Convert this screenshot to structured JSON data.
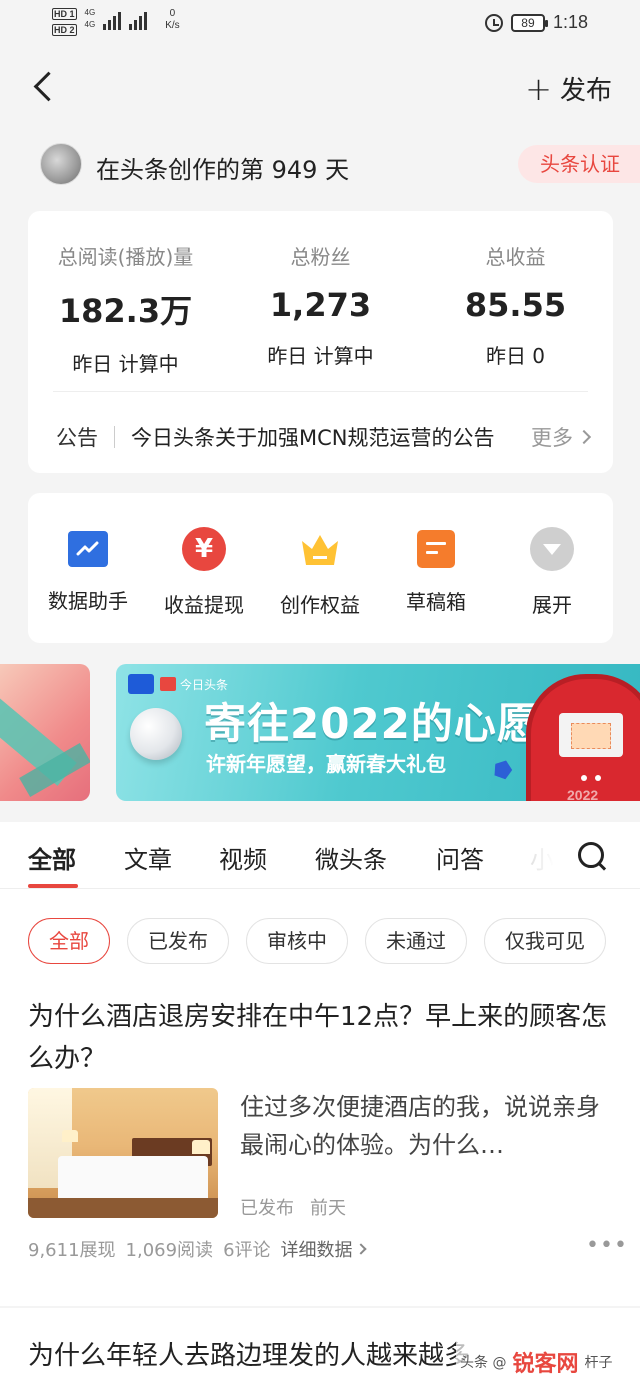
{
  "status_bar": {
    "hd1": "HD 1",
    "hd2": "HD 2",
    "net1": "4G",
    "net2": "4G",
    "speed_value": "0",
    "speed_unit": "K/s",
    "battery": "89",
    "time": "1:18"
  },
  "nav": {
    "publish_label": "发布",
    "plus_glyph": "+"
  },
  "creator": {
    "text": "在头条创作的第 949 天",
    "cert_label": "头条认证"
  },
  "stats": {
    "items": [
      {
        "label": "总阅读(播放)量",
        "value": "182.3万",
        "sub": "昨日 计算中"
      },
      {
        "label": "总粉丝",
        "value": "1,273",
        "sub": "昨日 计算中"
      },
      {
        "label": "总收益",
        "value": "85.55",
        "sub": "昨日 0"
      }
    ],
    "notice_tag": "公告",
    "notice_text": "今日头条关于加强MCN规范运营的公告",
    "notice_more": "更多"
  },
  "tools": [
    {
      "label": "数据助手",
      "icon": "chart-icon"
    },
    {
      "label": "收益提现",
      "icon": "yen-icon"
    },
    {
      "label": "创作权益",
      "icon": "crown-icon"
    },
    {
      "label": "草稿箱",
      "icon": "draft-icon"
    },
    {
      "label": "展开",
      "icon": "expand-icon"
    }
  ],
  "banner": {
    "brand": "今日头条",
    "title": "寄往2022的心愿",
    "subtitle": "许新年愿望，赢新春大礼包",
    "mailbox_year": "2022"
  },
  "tabs": [
    "全部",
    "文章",
    "视频",
    "微头条",
    "问答",
    "小"
  ],
  "chips": [
    "全部",
    "已发布",
    "审核中",
    "未通过",
    "仅我可见"
  ],
  "articles": [
    {
      "title": "为什么酒店退房安排在中午12点？早上来的顾客怎么办？",
      "summary": "住过多次便捷酒店的我，说说亲身最闹心的体验。为什么…",
      "status": "已发布",
      "time": "前天",
      "views": "9,611展现",
      "reads": "1,069阅读",
      "comments": "6评论",
      "detail": "详细数据"
    },
    {
      "title": "为什么年轻人去路边理发的人越来越多"
    }
  ],
  "watermark": {
    "prefix": "头条 @",
    "brand": "锐客网",
    "suffix": "杆子"
  },
  "colors": {
    "accent": "#e8473f",
    "cert_bg": "#fde6e6",
    "banner": "#4fc9cf"
  }
}
